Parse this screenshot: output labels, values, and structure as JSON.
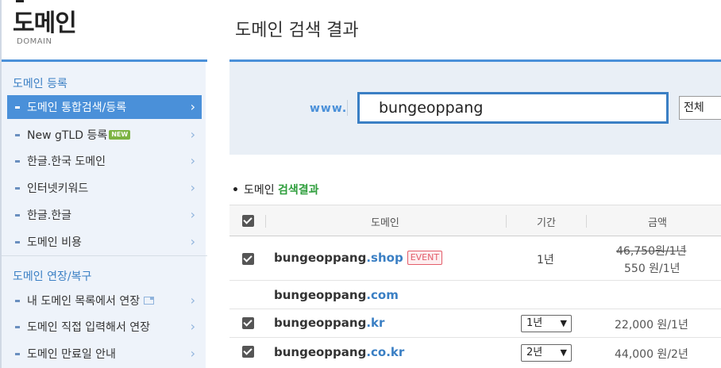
{
  "sidebar": {
    "title": "도메인",
    "subtitle": "DOMAIN",
    "sections": [
      {
        "heading": "도메인 등록"
      },
      {
        "heading": "도메인 연장/복구"
      }
    ],
    "items": [
      {
        "label": "도메인 통합검색/등록",
        "active": true
      },
      {
        "label": "New gTLD 등록",
        "badge": "NEW"
      },
      {
        "label": "한글.한국 도메인"
      },
      {
        "label": "인터넷키워드"
      },
      {
        "label": "한글.한글"
      },
      {
        "label": "도메인 비용"
      },
      {
        "label": "내 도메인 목록에서 연장"
      },
      {
        "label": "도메인 직접 입력해서 연장"
      },
      {
        "label": "도메인 만료일 안내"
      }
    ]
  },
  "main": {
    "page_title": "도메인 검색 결과",
    "search": {
      "prefix": "www.",
      "value": "bungeoppang",
      "scope": "전체"
    },
    "results_label": {
      "prefix": "도메인",
      "accent": "검색결과"
    },
    "table": {
      "headers": [
        "도메인",
        "기간",
        "금액"
      ],
      "rows": [
        {
          "name": "bungeoppang",
          "tld": ".shop",
          "checked": true,
          "badge": "EVENT",
          "period": "1년",
          "old_price": "46,750원/1년",
          "price": "550 원/1년"
        },
        {
          "name": "bungeoppang",
          "tld": ".com",
          "checked": false
        },
        {
          "name": "bungeoppang",
          "tld": ".kr",
          "checked": true,
          "period_select": "1년",
          "price": "22,000 원/1년"
        },
        {
          "name": "bungeoppang",
          "tld": ".co.kr",
          "checked": true,
          "period_select": "2년",
          "price": "44,000 원/2년"
        }
      ]
    }
  }
}
